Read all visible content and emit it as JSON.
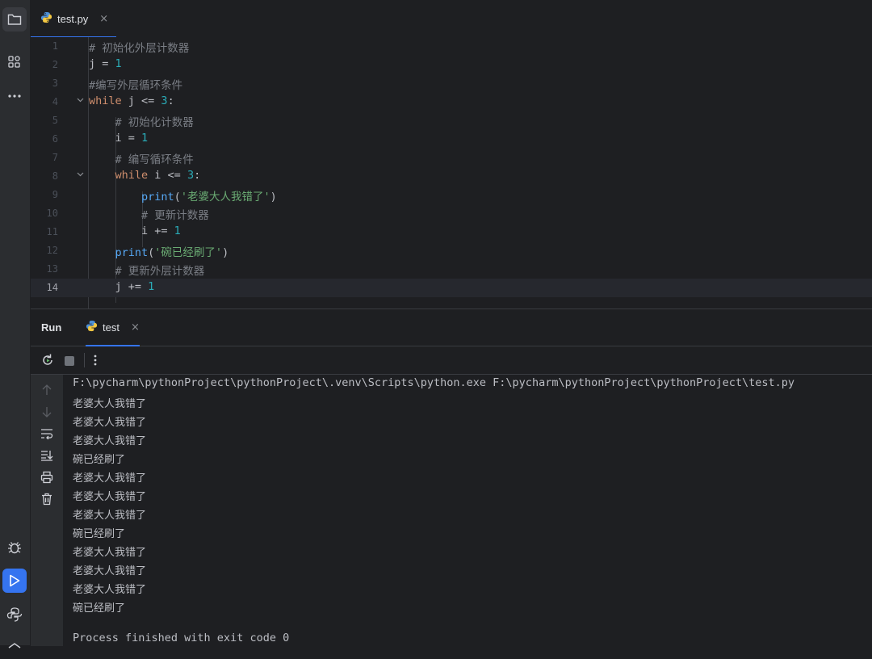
{
  "editor": {
    "tab": {
      "filename": "test.py",
      "close": "×",
      "icon": "python-file-icon"
    },
    "lines": [
      {
        "n": "1",
        "tokens": [
          {
            "t": "cm",
            "v": "# 初始化外层计数器"
          }
        ]
      },
      {
        "n": "2",
        "tokens": [
          {
            "t": "tx",
            "v": "j = "
          },
          {
            "t": "num",
            "v": "1"
          }
        ]
      },
      {
        "n": "3",
        "tokens": [
          {
            "t": "cm",
            "v": "#编写外层循环条件"
          }
        ]
      },
      {
        "n": "4",
        "fold": true,
        "tokens": [
          {
            "t": "kw",
            "v": "while"
          },
          {
            "t": "tx",
            "v": " j <= "
          },
          {
            "t": "num",
            "v": "3"
          },
          {
            "t": "tx",
            "v": ":"
          }
        ]
      },
      {
        "n": "5",
        "tokens": [
          {
            "t": "tx",
            "v": "    "
          },
          {
            "t": "cm",
            "v": "# 初始化计数器"
          }
        ]
      },
      {
        "n": "6",
        "tokens": [
          {
            "t": "tx",
            "v": "    i = "
          },
          {
            "t": "num",
            "v": "1"
          }
        ]
      },
      {
        "n": "7",
        "tokens": [
          {
            "t": "tx",
            "v": "    "
          },
          {
            "t": "cm",
            "v": "# 编写循环条件"
          }
        ]
      },
      {
        "n": "8",
        "fold": true,
        "tokens": [
          {
            "t": "tx",
            "v": "    "
          },
          {
            "t": "kw",
            "v": "while"
          },
          {
            "t": "tx",
            "v": " i <= "
          },
          {
            "t": "num",
            "v": "3"
          },
          {
            "t": "tx",
            "v": ":"
          }
        ]
      },
      {
        "n": "9",
        "tokens": [
          {
            "t": "tx",
            "v": "        "
          },
          {
            "t": "fn",
            "v": "print"
          },
          {
            "t": "tx",
            "v": "("
          },
          {
            "t": "str",
            "v": "'老婆大人我错了'"
          },
          {
            "t": "tx",
            "v": ")"
          }
        ]
      },
      {
        "n": "10",
        "tokens": [
          {
            "t": "tx",
            "v": "        "
          },
          {
            "t": "cm",
            "v": "# 更新计数器"
          }
        ]
      },
      {
        "n": "11",
        "tokens": [
          {
            "t": "tx",
            "v": "        i += "
          },
          {
            "t": "num",
            "v": "1"
          }
        ]
      },
      {
        "n": "12",
        "tokens": [
          {
            "t": "tx",
            "v": "    "
          },
          {
            "t": "fn",
            "v": "print"
          },
          {
            "t": "tx",
            "v": "("
          },
          {
            "t": "str",
            "v": "'碗已经刷了'"
          },
          {
            "t": "tx",
            "v": ")"
          }
        ]
      },
      {
        "n": "13",
        "tokens": [
          {
            "t": "tx",
            "v": "    "
          },
          {
            "t": "cm",
            "v": "# 更新外层计数器"
          }
        ]
      },
      {
        "n": "14",
        "current": true,
        "tokens": [
          {
            "t": "tx",
            "v": "    j += "
          },
          {
            "t": "num",
            "v": "1"
          }
        ]
      }
    ]
  },
  "run": {
    "title": "Run",
    "tab": {
      "label": "test",
      "close": "×",
      "icon": "python-file-icon"
    },
    "toolbar": [
      "rerun-icon",
      "stop-icon",
      "more-options-icon"
    ],
    "gutter": [
      "scroll-up-icon",
      "scroll-down-icon",
      "soft-wrap-icon",
      "scroll-to-end-icon",
      "print-icon",
      "clear-icon"
    ],
    "command": "F:\\pycharm\\pythonProject\\pythonProject\\.venv\\Scripts\\python.exe F:\\pycharm\\pythonProject\\pythonProject\\test.py",
    "output": [
      "老婆大人我错了",
      "老婆大人我错了",
      "老婆大人我错了",
      "碗已经刷了",
      "老婆大人我错了",
      "老婆大人我错了",
      "老婆大人我错了",
      "碗已经刷了",
      "老婆大人我错了",
      "老婆大人我错了",
      "老婆大人我错了",
      "碗已经刷了"
    ],
    "exit": "Process finished with exit code 0"
  },
  "stripe": {
    "top": [
      "project-icon",
      "structure-icon",
      "more-tools-icon"
    ],
    "bottom": [
      "debug-icon",
      "run-icon",
      "python-console-icon",
      "services-icon"
    ]
  },
  "colors": {
    "accent": "#3574f0",
    "keyword": "#cf8e6d",
    "number": "#2aacb8",
    "string": "#6aab73",
    "function": "#56a8f5",
    "comment": "#7a7e85"
  }
}
